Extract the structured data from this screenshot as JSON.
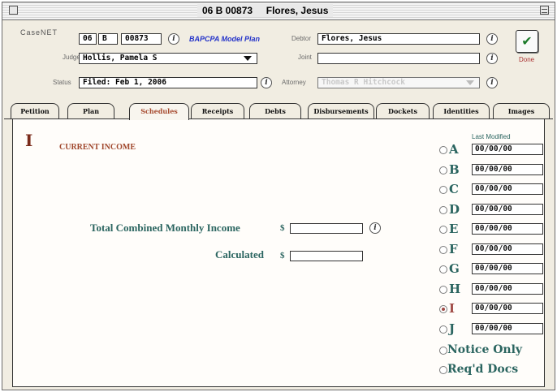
{
  "window": {
    "title_case": "06 B 00873",
    "title_name": "Flores, Jesus"
  },
  "header": {
    "logo": "CaseNET",
    "case_fields": [
      "06",
      "B",
      "00873"
    ],
    "plan_label": "BAPCPA Model Plan",
    "debtor_label": "Debtor",
    "debtor_value": "Flores, Jesus",
    "judge_label": "Judge",
    "judge_value": "Hollis, Pamela S",
    "joint_label": "Joint",
    "joint_value": "",
    "status_label": "Status",
    "status_value": "Filed:  Feb 1, 2006",
    "attorney_label": "Attorney",
    "attorney_value": "Thomas R Hitchcock",
    "done_label": "Done",
    "done_icon": "check-icon",
    "info_glyph": "i"
  },
  "tabs": [
    {
      "label": "Petition",
      "active": false
    },
    {
      "label": "Plan",
      "active": false
    },
    {
      "label": "Schedules",
      "active": true
    },
    {
      "label": "Receipts",
      "active": false
    },
    {
      "label": "Debts",
      "active": false
    },
    {
      "label": "Disbursements",
      "active": false
    },
    {
      "label": "Dockets",
      "active": false
    },
    {
      "label": "Identities",
      "active": false
    },
    {
      "label": "Images",
      "active": false
    }
  ],
  "schedule": {
    "letter": "I",
    "title": "CURRENT INCOME",
    "total_label": "Total Combined Monthly Income",
    "total_dollar": "$",
    "total_value": "",
    "calculated_label": "Calculated",
    "calculated_dollar": "$",
    "calculated_value": ""
  },
  "schedules_list": {
    "last_modified_label": "Last Modified",
    "selected": "I",
    "items": [
      {
        "letter": "A",
        "date": "00/00/00"
      },
      {
        "letter": "B",
        "date": "00/00/00"
      },
      {
        "letter": "C",
        "date": "00/00/00"
      },
      {
        "letter": "D",
        "date": "00/00/00"
      },
      {
        "letter": "E",
        "date": "00/00/00"
      },
      {
        "letter": "F",
        "date": "00/00/00"
      },
      {
        "letter": "G",
        "date": "00/00/00"
      },
      {
        "letter": "H",
        "date": "00/00/00"
      },
      {
        "letter": "I",
        "date": "00/00/00"
      },
      {
        "letter": "J",
        "date": "00/00/00"
      }
    ],
    "extra": [
      "Notice Only",
      "Req'd Docs"
    ]
  }
}
